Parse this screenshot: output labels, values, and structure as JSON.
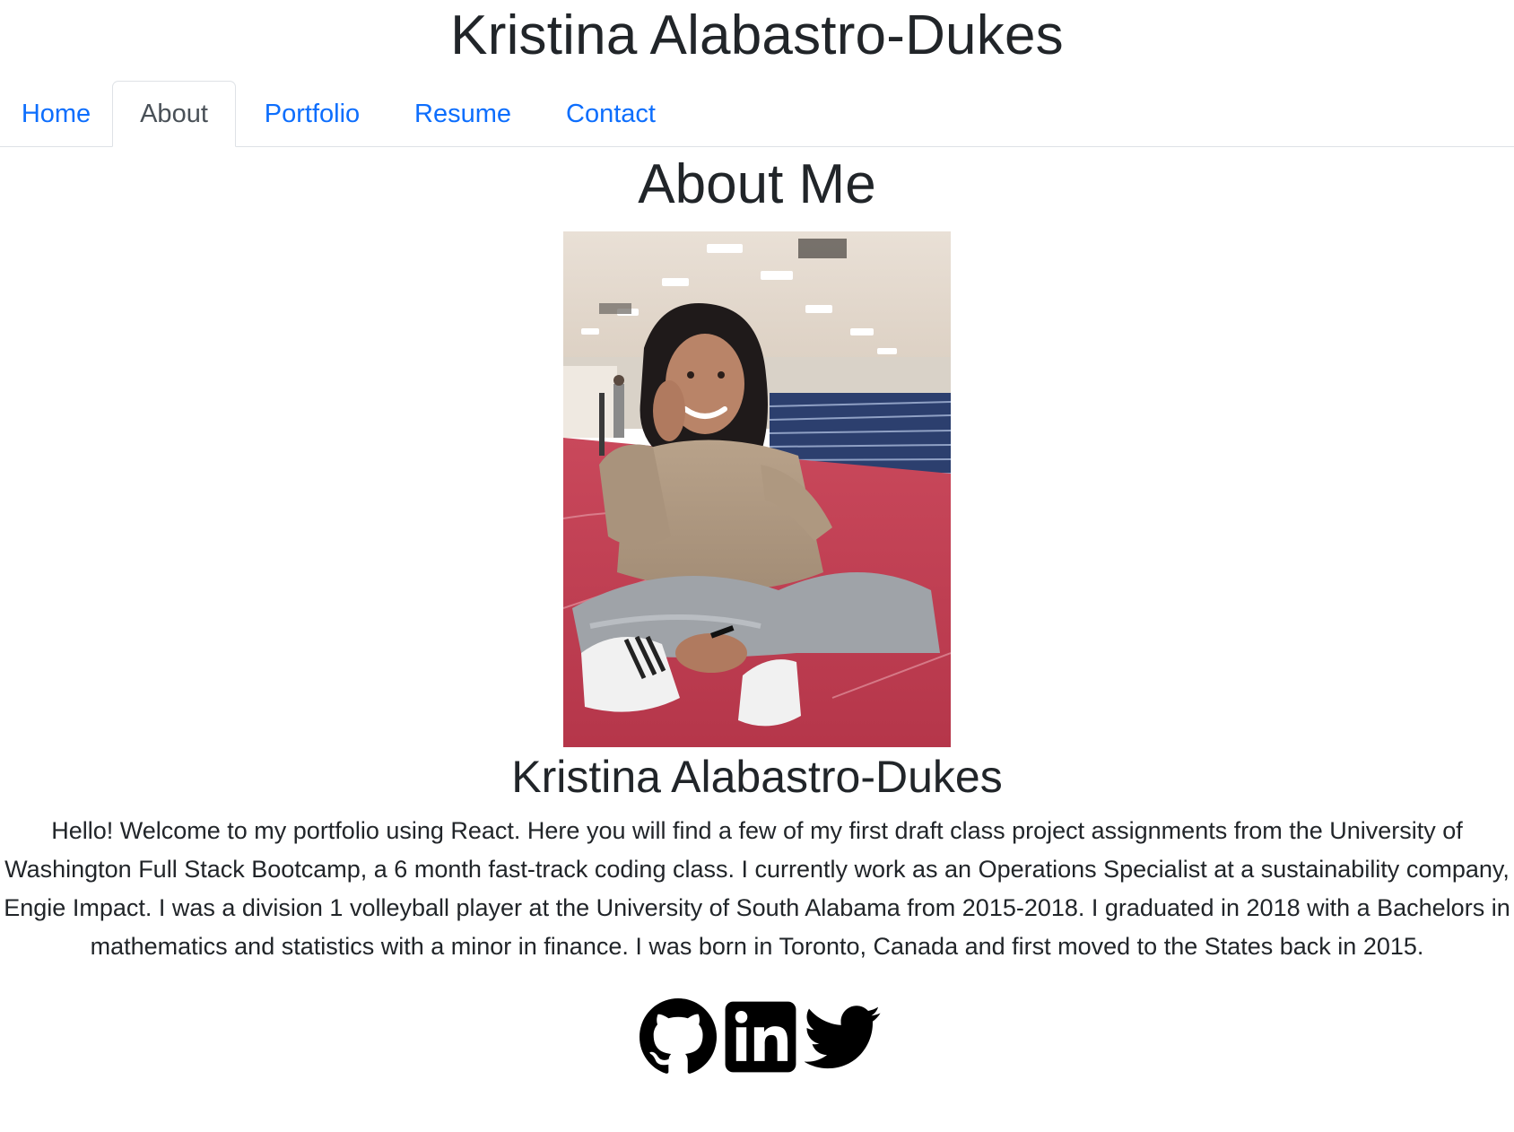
{
  "header": {
    "title": "Kristina Alabastro-Dukes"
  },
  "nav": {
    "tabs": [
      {
        "label": "Home",
        "active": false
      },
      {
        "label": "About",
        "active": true
      },
      {
        "label": "Portfolio",
        "active": false
      },
      {
        "label": "Resume",
        "active": false
      },
      {
        "label": "Contact",
        "active": false
      }
    ]
  },
  "about": {
    "heading": "About Me",
    "name": "Kristina Alabastro-Dukes",
    "bio": "Hello! Welcome to my portfolio using React. Here you will find a few of my first draft class project assignments from the University of Washington Full Stack Bootcamp, a 6 month fast-track coding class. I currently work as an Operations Specialist at a sustainability company, Engie Impact. I was a division 1 volleyball player at the University of South Alabama from 2015-2018. I graduated in 2018 with a Bachelors in mathematics and statistics with a minor in finance. I was born in Toronto, Canada and first moved to the States back in 2015."
  },
  "social": {
    "icons": [
      "github-icon",
      "linkedin-icon",
      "twitter-icon"
    ]
  },
  "colors": {
    "link": "#0d6efd",
    "active_tab_text": "#495057",
    "text": "#212529",
    "border": "#dee2e6"
  }
}
